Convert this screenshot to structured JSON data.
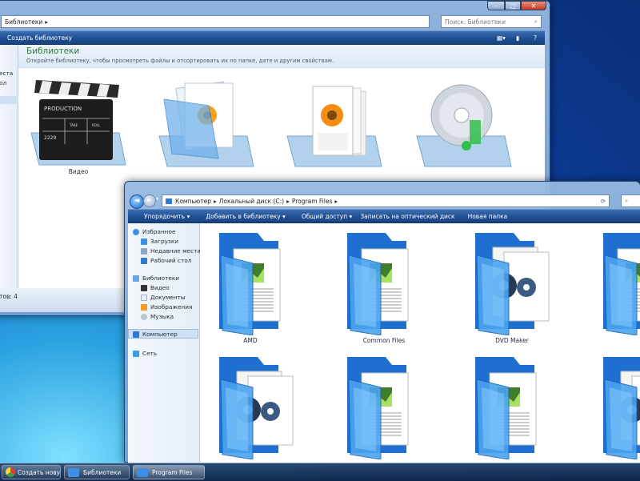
{
  "back_window": {
    "breadcrumb": "Библиотеки",
    "search_placeholder": "Поиск: Библиотеки",
    "create_library": "Создать библиотеку",
    "header_title": "Библиотеки",
    "header_subtitle": "Откройте библиотеку, чтобы просмотреть файлы и отсортировать их по папке, дате и другим свойствам.",
    "nav_fragments": [
      "еста",
      "ол"
    ],
    "items": [
      {
        "label": "Видео"
      },
      {
        "label": ""
      },
      {
        "label": ""
      },
      {
        "label": ""
      }
    ],
    "status": "тов: 4"
  },
  "front_window": {
    "breadcrumb": [
      "Компьютер",
      "Локальный диск (C:)",
      "Program Files"
    ],
    "toolbar": [
      "Упорядочить",
      "Добавить в библиотеку",
      "Общий доступ",
      "Записать на оптический диск",
      "Новая папка"
    ],
    "nav": {
      "favorites_header": "Избранное",
      "favorites": [
        "Загрузки",
        "Недавние места",
        "Рабочий стол"
      ],
      "libraries_header": "Библиотеки",
      "libraries": [
        "Видео",
        "Документы",
        "Изображения",
        "Музыка"
      ],
      "computer": "Компьютер",
      "network": "Сеть"
    },
    "folders": [
      {
        "label": "AMD",
        "type": "docs"
      },
      {
        "label": "Common Files",
        "type": "docs"
      },
      {
        "label": "DVD Maker",
        "type": "app"
      },
      {
        "label": "",
        "type": "docs"
      },
      {
        "label": "",
        "type": "app"
      },
      {
        "label": "",
        "type": "docs"
      },
      {
        "label": "",
        "type": "docs"
      },
      {
        "label": "",
        "type": "app"
      }
    ]
  },
  "taskbar": {
    "items": [
      "Создать новую т...",
      "Библиотеки",
      "Program Files"
    ]
  },
  "colors": {
    "header_green": "#2e7d32",
    "window_frame": "#7aa3d6",
    "folder_blue": "#2f86e0",
    "taskbar": "#1a3a66"
  }
}
